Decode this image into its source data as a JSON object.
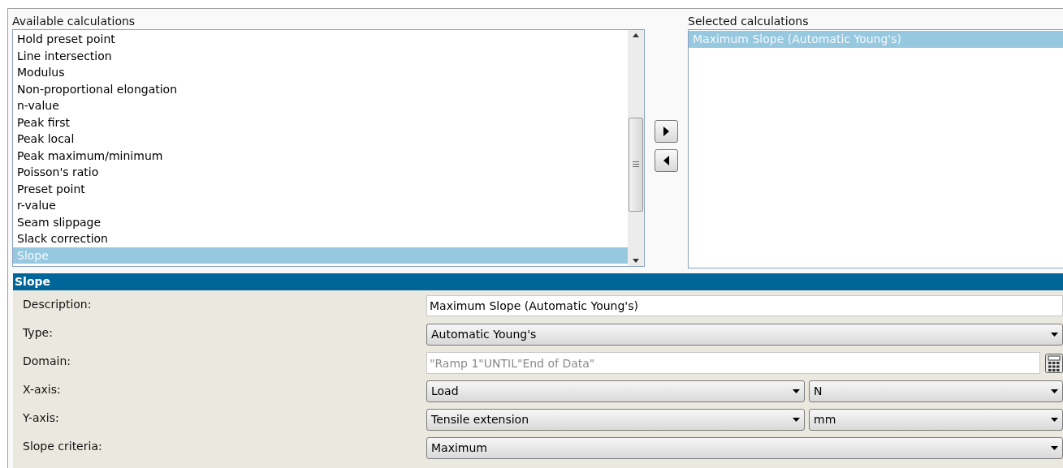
{
  "available": {
    "label": "Available calculations",
    "items": [
      {
        "label": "Hold preset point",
        "selected": false
      },
      {
        "label": "Line intersection",
        "selected": false
      },
      {
        "label": "Modulus",
        "selected": false
      },
      {
        "label": "Non-proportional elongation",
        "selected": false
      },
      {
        "label": "n-value",
        "selected": false
      },
      {
        "label": "Peak first",
        "selected": false
      },
      {
        "label": "Peak local",
        "selected": false
      },
      {
        "label": "Peak maximum/minimum",
        "selected": false
      },
      {
        "label": "Poisson's ratio",
        "selected": false
      },
      {
        "label": "Preset point",
        "selected": false
      },
      {
        "label": "r-value",
        "selected": false
      },
      {
        "label": "Seam slippage",
        "selected": false
      },
      {
        "label": "Slack correction",
        "selected": false
      },
      {
        "label": "Slope",
        "selected": true
      }
    ]
  },
  "selected_list": {
    "label": "Selected calculations",
    "items": [
      {
        "label": "Maximum Slope (Automatic Young's)",
        "selected": true
      }
    ]
  },
  "details": {
    "title": "Slope",
    "rows": [
      {
        "kind": "text",
        "label": "Description:",
        "value": "Maximum Slope (Automatic Young's)"
      },
      {
        "kind": "select",
        "label": "Type:",
        "value": "Automatic Young's"
      },
      {
        "kind": "domain",
        "label": "Domain:",
        "placeholder": "\"Ramp 1\"UNTIL\"End of Data\""
      },
      {
        "kind": "select_pair",
        "label": "X-axis:",
        "value": "Load",
        "unit": "N"
      },
      {
        "kind": "select_pair",
        "label": "Y-axis:",
        "value": "Tensile extension",
        "unit": "mm"
      },
      {
        "kind": "select",
        "label": "Slope criteria:",
        "value": "Maximum"
      }
    ]
  }
}
